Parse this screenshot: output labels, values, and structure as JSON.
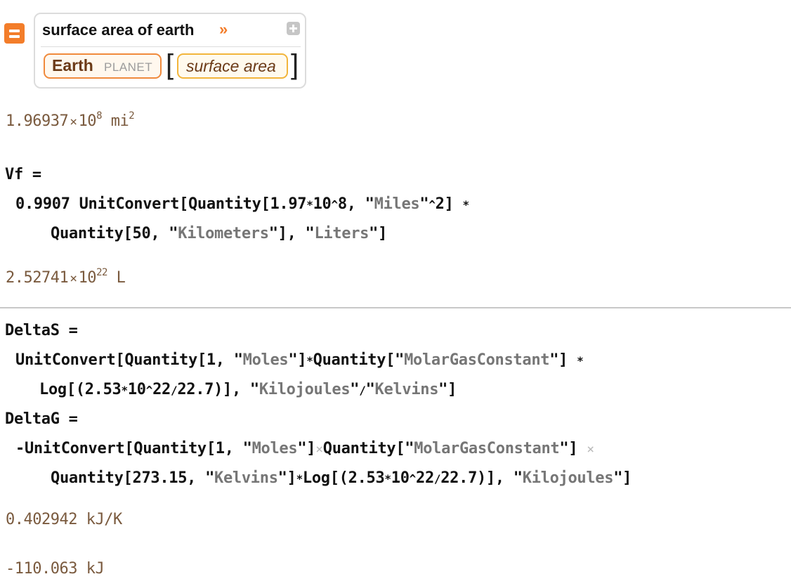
{
  "wolfram_alpha_input": {
    "query": "surface area of earth",
    "chevron": "»",
    "entity": {
      "name": "Earth",
      "type": "PLANET"
    },
    "open_bracket": "[",
    "close_bracket": "]",
    "property": "surface area",
    "icons": {
      "input_type": "equals-icon",
      "expand": "plus-icon"
    },
    "colors": {
      "accent": "#f37d2a",
      "entity_border": "#f08a3c",
      "property_border": "#f2b53c"
    }
  },
  "outputs": {
    "surface_area": {
      "mantissa": "1.96937",
      "times": "×",
      "base": "10",
      "exponent": "8",
      "unit": "mi",
      "unit_exp": "2"
    },
    "volume": {
      "mantissa": "2.52741",
      "times": "×",
      "base": "10",
      "exponent": "22",
      "unit": "L"
    },
    "delta_s": {
      "value": "0.402942",
      "unit": "kJ/K"
    },
    "delta_g": {
      "value": "-110.063",
      "unit": "kJ"
    }
  },
  "inputs": {
    "vf": {
      "lhs": "Vf =",
      "line1": {
        "t1": "0.9907 UnitConvert[Quantity[1.97",
        "star1": "*",
        "t2": "10",
        "caret1": "^",
        "t3": "8, ",
        "s1": "Miles",
        "caret2": "^",
        "t4": "2]",
        "star2": "*"
      },
      "line2": {
        "t1": "Quantity[50, ",
        "s1": "Kilometers",
        "t2": "], ",
        "s2": "Liters",
        "t3": "]"
      }
    },
    "delta_s": {
      "lhs": "DeltaS =",
      "line1": {
        "t1": "UnitConvert[Quantity[1, ",
        "s1": "Moles",
        "t2": "]",
        "star1": "*",
        "t3": "Quantity[",
        "s2": "MolarGasConstant",
        "t4": "]",
        "star2": "*"
      },
      "line2": {
        "t1": "Log[(2.53",
        "star1": "*",
        "t2": "10",
        "caret": "^",
        "t3": "22",
        "slash": "/",
        "t4": "22.7)], ",
        "s1": "Kilojoules",
        "slash2": "/",
        "s2": "Kelvins",
        "t5": "]"
      }
    },
    "delta_g": {
      "lhs": "DeltaG =",
      "line1": {
        "t1": "-UnitConvert[Quantity[1, ",
        "s1": "Moles",
        "t2": "]",
        "x1": "×",
        "t3": "Quantity[",
        "s2": "MolarGasConstant",
        "t4": "]",
        "x2": "×"
      },
      "line2": {
        "t1": "Quantity[273.15, ",
        "s1": "Kelvins",
        "t2": "]",
        "star1": "*",
        "t3": "Log[(2.53",
        "star2": "*",
        "t4": "10",
        "caret": "^",
        "t5": "22",
        "slash": "/",
        "t6": "22.7)], ",
        "s2": "Kilojoules",
        "t7": "]"
      }
    }
  }
}
